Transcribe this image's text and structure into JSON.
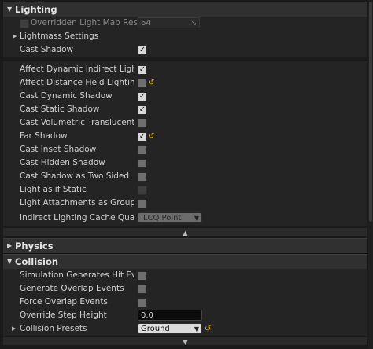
{
  "lighting": {
    "title": "Lighting",
    "overridden_lightmap": {
      "label": "Overridden Light Map Res",
      "value": "64",
      "enabled": false
    },
    "lightmass_settings": "Lightmass Settings",
    "cast_shadow": {
      "label": "Cast Shadow",
      "checked": true
    },
    "advanced": [
      {
        "label": "Affect Dynamic Indirect Lighting",
        "checked": true,
        "reset": false
      },
      {
        "label": "Affect Distance Field Lighting",
        "checked": false,
        "reset": true
      },
      {
        "label": "Cast Dynamic Shadow",
        "checked": true,
        "reset": false
      },
      {
        "label": "Cast Static Shadow",
        "checked": true,
        "reset": false
      },
      {
        "label": "Cast Volumetric Translucent Shadow",
        "checked": false,
        "reset": false
      },
      {
        "label": "Far Shadow",
        "checked": true,
        "reset": true
      },
      {
        "label": "Cast Inset Shadow",
        "checked": false,
        "reset": false
      },
      {
        "label": "Cast Hidden Shadow",
        "checked": false,
        "reset": false
      },
      {
        "label": "Cast Shadow as Two Sided",
        "checked": false,
        "reset": false
      },
      {
        "label": "Light as if Static",
        "checked": false,
        "disabled": true,
        "reset": false
      },
      {
        "label": "Light Attachments as Group",
        "checked": false,
        "reset": false
      }
    ],
    "indirect_cache": {
      "label": "Indirect Lighting Cache Quality",
      "value": "ILCQ Point"
    }
  },
  "physics": {
    "title": "Physics"
  },
  "collision": {
    "title": "Collision",
    "sim_hit_events": "Simulation Generates Hit Events",
    "gen_overlap": "Generate Overlap Events",
    "force_overlap": "Force Overlap Events",
    "step_height": {
      "label": "Override Step Height",
      "value": "0.0"
    },
    "presets": {
      "label": "Collision Presets",
      "value": "Ground"
    }
  },
  "icons": {
    "expand": "triangle-right-icon",
    "collapse": "triangle-down-icon",
    "reset": "reset-arrow-icon",
    "advanced": "chevron-up-icon"
  }
}
